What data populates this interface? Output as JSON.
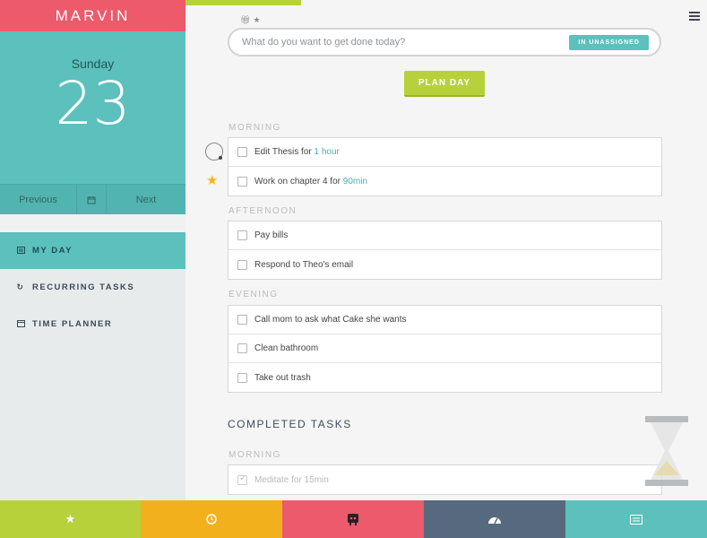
{
  "app": {
    "title": "MARVIN"
  },
  "date": {
    "day_name": "Sunday",
    "day_number": "23"
  },
  "date_nav": {
    "previous": "Previous",
    "next": "Next"
  },
  "sidebar": {
    "items": [
      {
        "label": "MY DAY",
        "icon": "list-icon",
        "active": true
      },
      {
        "label": "RECURRING TASKS",
        "icon": "refresh-icon",
        "active": false
      },
      {
        "label": "TIME PLANNER",
        "icon": "calendar-icon",
        "active": false
      }
    ]
  },
  "search": {
    "placeholder": "What do you want to get done today?",
    "tag": "IN UNASSIGNED"
  },
  "plan_day": {
    "label": "PLAN DAY"
  },
  "sections": {
    "morning": {
      "label": "MORNING",
      "tasks": [
        {
          "text": "Edit Thesis for ",
          "highlight": "1 hour"
        },
        {
          "text": "Work on chapter 4 for ",
          "highlight": "90min"
        }
      ]
    },
    "afternoon": {
      "label": "AFTERNOON",
      "tasks": [
        {
          "text": "Pay bills"
        },
        {
          "text": "Respond to Theo's email"
        }
      ]
    },
    "evening": {
      "label": "EVENING",
      "tasks": [
        {
          "text": "Call mom to ask what Cake she wants"
        },
        {
          "text": "Clean bathroom"
        },
        {
          "text": "Take out trash"
        }
      ]
    }
  },
  "completed": {
    "title": "COMPLETED TASKS",
    "morning_label": "MORNING",
    "tasks": [
      {
        "text": "Meditate for 15min"
      }
    ]
  },
  "bottom_bar": [
    {
      "icon": "star-icon",
      "color": "#b7d13b"
    },
    {
      "icon": "clock-icon",
      "color": "#f2b01d"
    },
    {
      "icon": "robot-icon",
      "color": "#ec5a6b"
    },
    {
      "icon": "gauge-icon",
      "color": "#56697f"
    },
    {
      "icon": "list-icon",
      "color": "#5cc0bd"
    }
  ],
  "colors": {
    "brand": "#ec5a6b",
    "teal": "#5cc0bd",
    "green": "#b7d13b",
    "star": "#f3b41b"
  }
}
